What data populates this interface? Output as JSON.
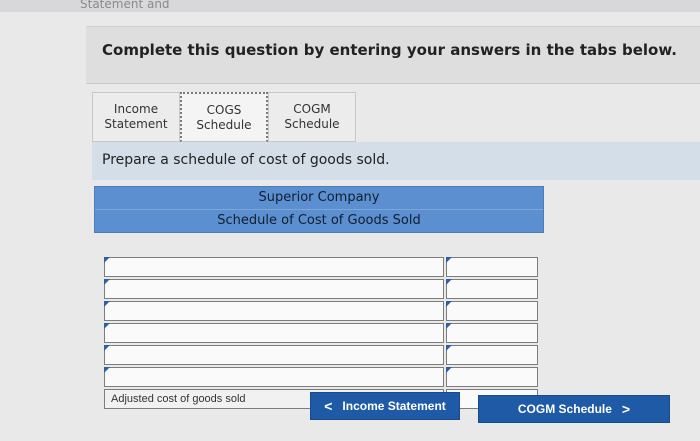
{
  "top_strip": {
    "text": "Statement and"
  },
  "header": {
    "prompt": "Complete this question by entering your answers in the tabs below."
  },
  "tabs": [
    {
      "label": "Income\nStatement"
    },
    {
      "label": "COGS\nSchedule"
    },
    {
      "label": "COGM\nSchedule"
    }
  ],
  "instruction": "Prepare a schedule of cost of goods sold.",
  "schedule": {
    "company": "Superior Company",
    "title": "Schedule of Cost of Goods Sold",
    "final_label": "Adjusted cost of goods sold"
  },
  "nav": {
    "prev_label": "Income Statement",
    "prev_icon": "<",
    "next_label": "COGM Schedule",
    "next_icon": ">"
  }
}
